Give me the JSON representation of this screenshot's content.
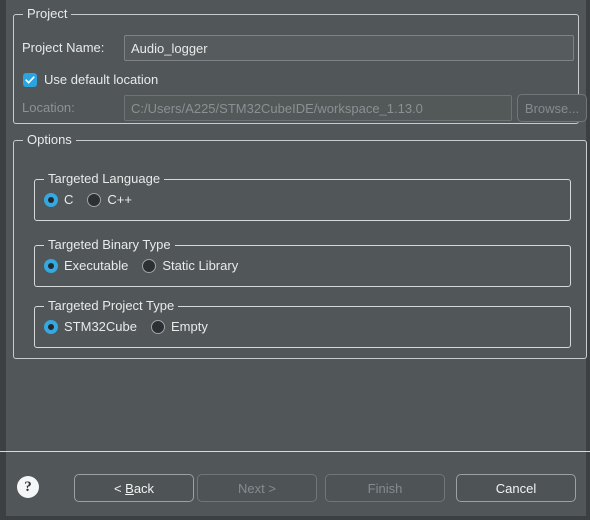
{
  "project_group": {
    "title": "Project",
    "name_label": "Project Name:",
    "name_value": "Audio_logger",
    "use_default_location_label": "Use default location",
    "use_default_location_checked": true,
    "location_label": "Location:",
    "location_value": "C:/Users/A225/STM32CubeIDE/workspace_1.13.0",
    "browse_label": "Browse..."
  },
  "options_group": {
    "title": "Options",
    "language": {
      "title": "Targeted Language",
      "options": [
        {
          "label": "C",
          "selected": true
        },
        {
          "label": "C++",
          "selected": false
        }
      ]
    },
    "binary_type": {
      "title": "Targeted Binary Type",
      "options": [
        {
          "label": "Executable",
          "selected": true
        },
        {
          "label": "Static Library",
          "selected": false
        }
      ]
    },
    "project_type": {
      "title": "Targeted Project Type",
      "options": [
        {
          "label": "STM32Cube",
          "selected": true
        },
        {
          "label": "Empty",
          "selected": false
        }
      ]
    }
  },
  "buttons": {
    "help_icon": "?",
    "back": "< Back",
    "back_prefix": "< ",
    "back_mnemonic": "B",
    "back_suffix": "ack",
    "next": "Next >",
    "finish": "Finish",
    "cancel": "Cancel"
  },
  "colors": {
    "background": "#515659",
    "accent": "#34a8e0",
    "border": "#c9cccd",
    "text": "#e9eaea",
    "text_disabled": "#8d9295"
  }
}
